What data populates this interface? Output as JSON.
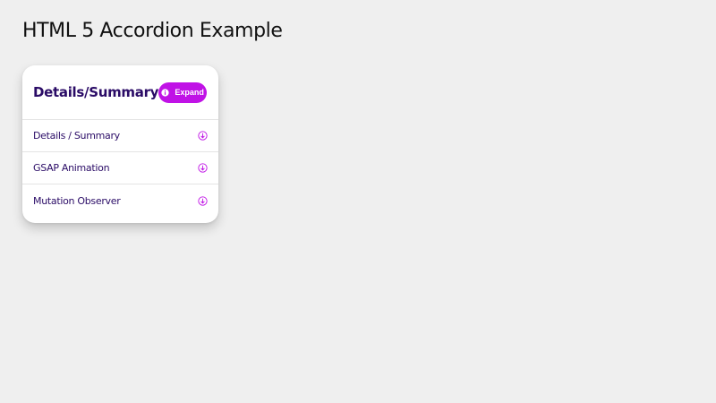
{
  "page": {
    "title": "HTML 5 Accordion Example"
  },
  "card": {
    "title": "Details/Summary",
    "expand_label": "Expand",
    "expand_icon": "info-circle-icon",
    "items": [
      {
        "label": "Details / Summary",
        "icon": "arrow-down-circle-icon"
      },
      {
        "label": "GSAP Animation",
        "icon": "arrow-down-circle-icon"
      },
      {
        "label": "Mutation Observer",
        "icon": "arrow-down-circle-icon"
      }
    ]
  },
  "colors": {
    "background": "#efefef",
    "accent": "#c012e6",
    "text_dark_purple": "#2a0b66"
  }
}
